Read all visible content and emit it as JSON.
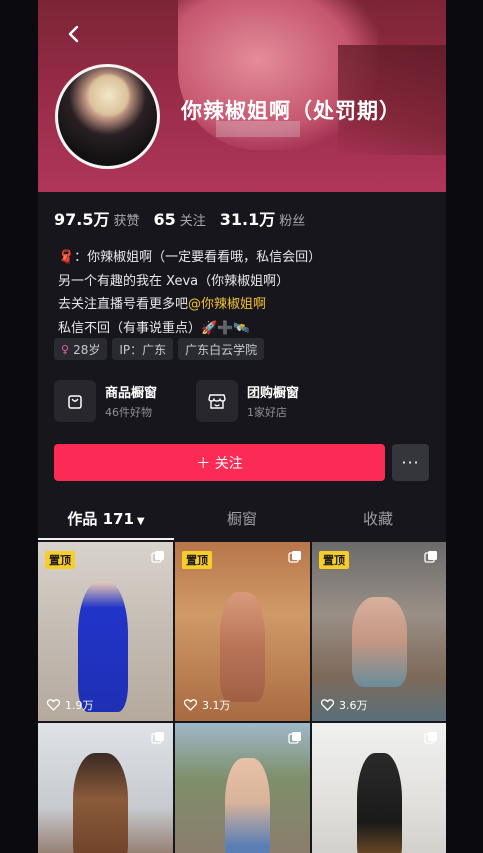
{
  "header": {
    "nickname": "你辣椒姐啊（处罚期）"
  },
  "stats": [
    {
      "value": "97.5万",
      "label": "获赞"
    },
    {
      "value": "65",
      "label": "关注"
    },
    {
      "value": "31.1万",
      "label": "粉丝"
    }
  ],
  "bio": {
    "line1": "🧣：你辣椒姐啊（一定要看看哦，私信会回）",
    "line2": "另一个有趣的我在 Xeva（你辣椒姐啊）",
    "line3_prefix": "去关注直播号看更多吧",
    "line3_mention": "@你辣椒姐啊",
    "line4": "私信不回（有事说重点）🚀➕🛰️"
  },
  "tags": [
    "28岁",
    "IP：广东",
    "广东白云学院"
  ],
  "shop_window": {
    "title": "商品橱窗",
    "subtitle": "46件好物"
  },
  "group_buy": {
    "title": "团购橱窗",
    "subtitle": "1家好店"
  },
  "buttons": {
    "follow": "＋ 关注",
    "more": "···"
  },
  "tabs": [
    {
      "label": "作品 171"
    },
    {
      "label": "橱窗"
    },
    {
      "label": "收藏"
    }
  ],
  "videos": [
    {
      "pinned": "置顶",
      "likes": "1.9万"
    },
    {
      "pinned": "置顶",
      "likes": "3.1万"
    },
    {
      "pinned": "置顶",
      "likes": "3.6万"
    },
    {
      "pinned": "",
      "likes": ""
    },
    {
      "pinned": "",
      "likes": ""
    },
    {
      "pinned": "",
      "likes": ""
    }
  ],
  "colors": {
    "accent": "#fc2b55",
    "pin": "#f7cd2a",
    "mention": "#f5c136"
  }
}
